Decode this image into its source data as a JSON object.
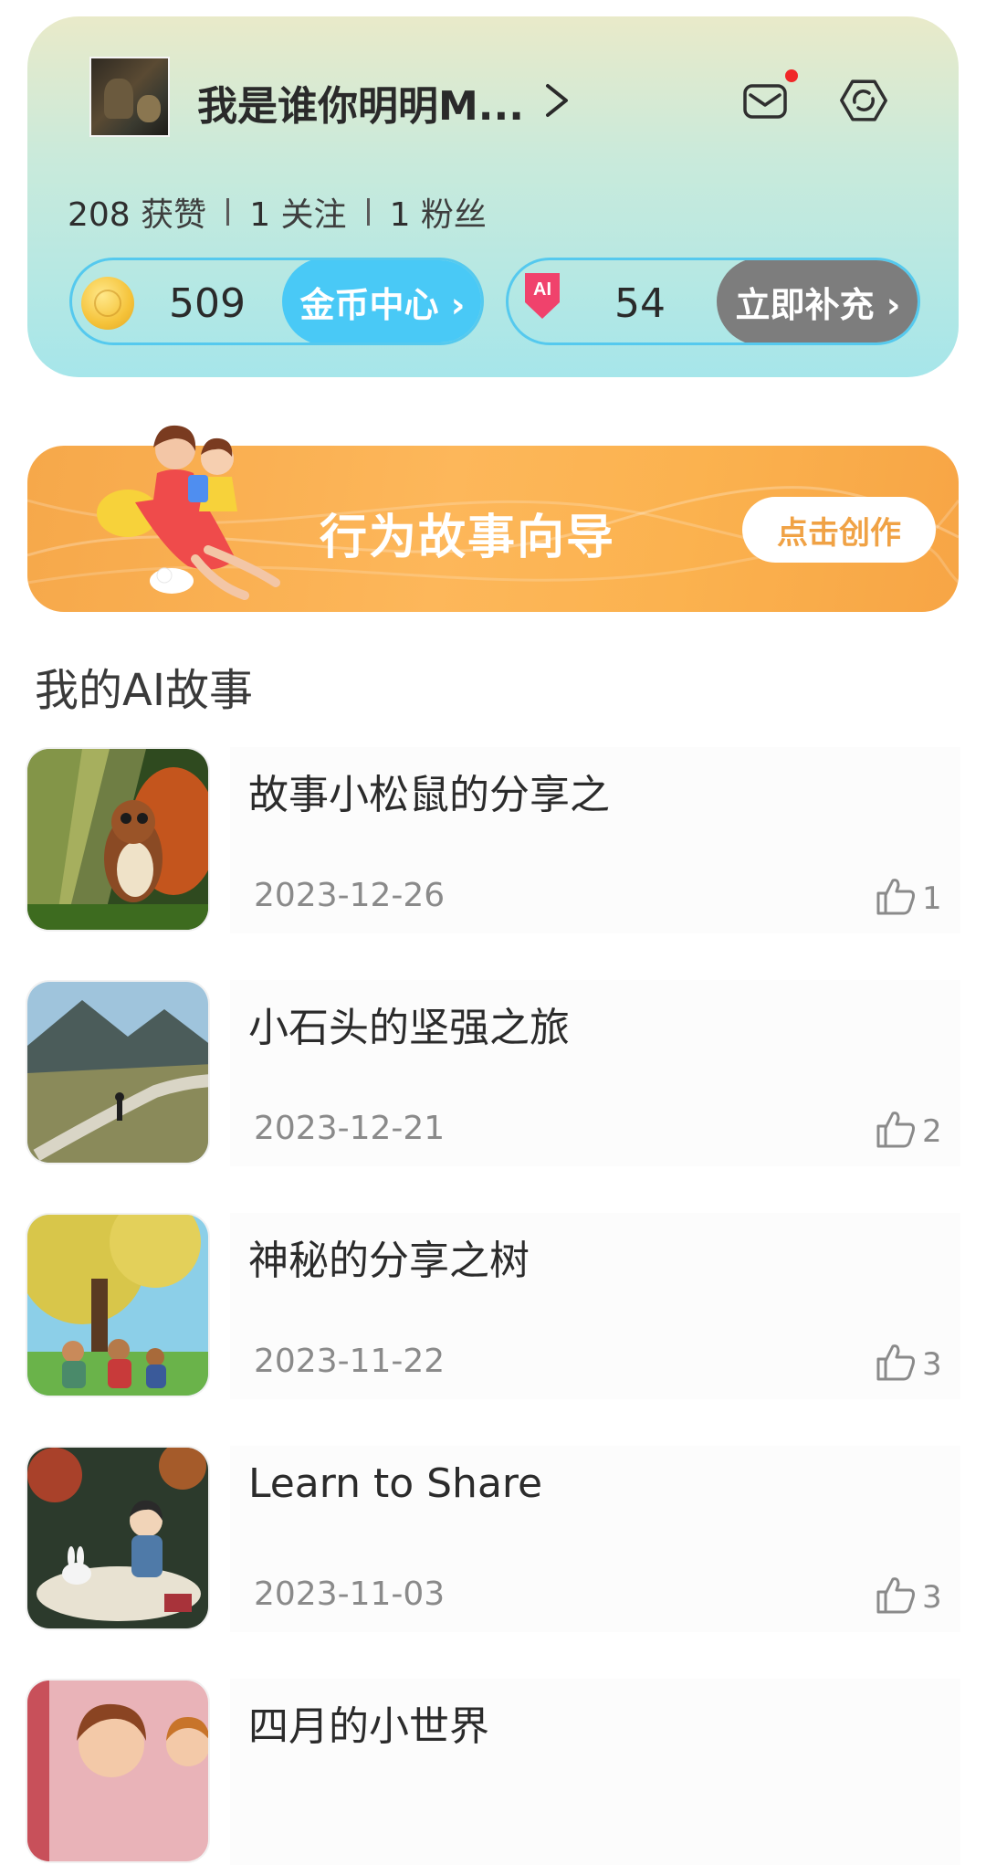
{
  "profile": {
    "username": "我是谁你明明M...",
    "stats": [
      {
        "value": "208",
        "label": "获赞"
      },
      {
        "value": "1",
        "label": "关注"
      },
      {
        "value": "1",
        "label": "粉丝"
      }
    ],
    "coins": {
      "value": "509",
      "button": "金币中心 ›"
    },
    "ai_points": {
      "badge": "AI",
      "value": "54",
      "button": "立即补充 ›"
    }
  },
  "banner": {
    "title": "行为故事向导",
    "button": "点击创作"
  },
  "section_title": "我的AI故事",
  "stories": [
    {
      "title": "故事小松鼠的分享之",
      "date": "2023-12-26",
      "likes": "1",
      "thumb": "squirrel"
    },
    {
      "title": "小石头的坚强之旅",
      "date": "2023-12-21",
      "likes": "2",
      "thumb": "mountain"
    },
    {
      "title": "神秘的分享之树",
      "date": "2023-11-22",
      "likes": "3",
      "thumb": "tree"
    },
    {
      "title": "Learn to Share",
      "date": "2023-11-03",
      "likes": "3",
      "thumb": "girl-rabbit"
    },
    {
      "title": "四月的小世界",
      "date": "",
      "likes": "",
      "thumb": "girls-room"
    }
  ],
  "colors": {
    "accent_blue": "#49c9f6",
    "banner_orange": "#fdb75a",
    "notification_red": "#f02828"
  }
}
